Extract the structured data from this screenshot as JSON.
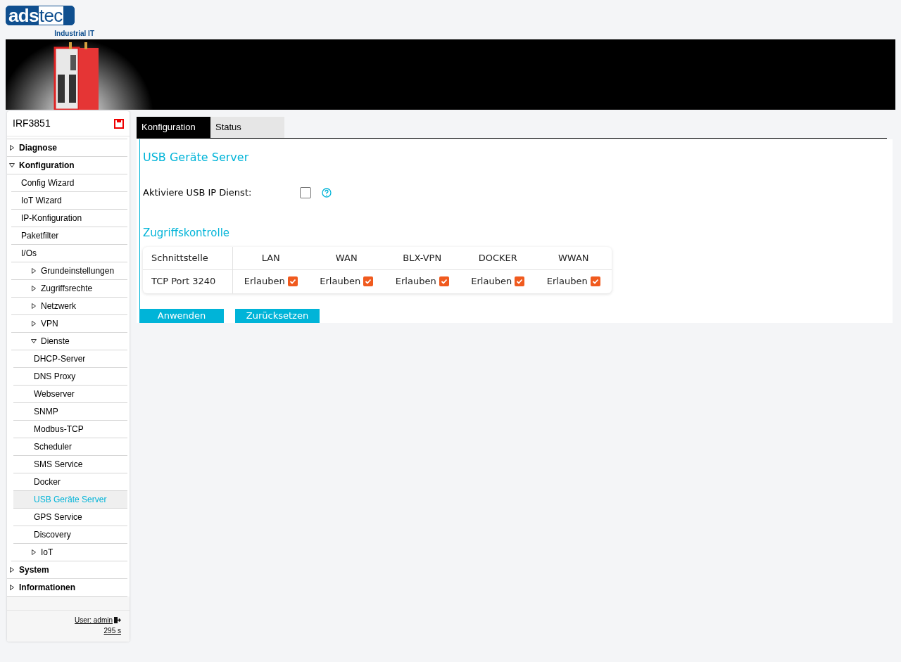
{
  "logo": {
    "left": "ads",
    "right": "tec",
    "tagline": "Industrial IT"
  },
  "sidebar": {
    "device": "IRF3851",
    "items": [
      {
        "label": "Diagnose",
        "expanded": false,
        "selected": false
      },
      {
        "label": "Konfiguration",
        "expanded": true,
        "selected": false,
        "children": [
          {
            "label": "Config Wizard",
            "selected": false
          },
          {
            "label": "IoT Wizard",
            "selected": false
          },
          {
            "label": "IP-Konfiguration",
            "selected": false
          },
          {
            "label": "Paketfilter",
            "selected": false
          },
          {
            "label": "I/Os",
            "selected": false,
            "children": [
              {
                "label": "Grundeinstellungen",
                "expanded": false,
                "selected": false
              },
              {
                "label": "Zugriffsrechte",
                "expanded": false,
                "selected": false
              },
              {
                "label": "Netzwerk",
                "expanded": false,
                "selected": false
              },
              {
                "label": "VPN",
                "expanded": false,
                "selected": false
              },
              {
                "label": "Dienste",
                "expanded": true,
                "selected": false,
                "children": [
                  {
                    "label": "DHCP-Server",
                    "selected": false
                  },
                  {
                    "label": "DNS Proxy",
                    "selected": false
                  },
                  {
                    "label": "Webserver",
                    "selected": false
                  },
                  {
                    "label": "SNMP",
                    "selected": false
                  },
                  {
                    "label": "Modbus-TCP",
                    "selected": false
                  },
                  {
                    "label": "Scheduler",
                    "selected": false
                  },
                  {
                    "label": "SMS Service",
                    "selected": false
                  },
                  {
                    "label": "Docker",
                    "selected": false
                  },
                  {
                    "label": "USB Geräte Server",
                    "selected": true
                  },
                  {
                    "label": "GPS Service",
                    "selected": false
                  },
                  {
                    "label": "Discovery",
                    "selected": false
                  }
                ]
              },
              {
                "label": "IoT",
                "expanded": false,
                "selected": false
              }
            ]
          }
        ]
      },
      {
        "label": "System",
        "expanded": false,
        "selected": false
      },
      {
        "label": "Informationen",
        "expanded": false,
        "selected": false
      }
    ],
    "user": "User: admin",
    "timer": "295 s"
  },
  "tabs": [
    {
      "label": "Konfiguration",
      "selected": true
    },
    {
      "label": "Status",
      "selected": false
    }
  ],
  "page": {
    "title": "USB Geräte Server",
    "service_label": "Aktiviere USB IP Dienst:",
    "service_enabled": false,
    "access_title": "Zugriffskontrolle",
    "table": {
      "columns": [
        "Schnittstelle",
        "LAN",
        "WAN",
        "BLX-VPN",
        "DOCKER",
        "WWAN"
      ],
      "rows": [
        {
          "cells": [
            {
              "kind": "text",
              "label": "TCP Port 3240"
            },
            {
              "kind": "checkbox",
              "label": "Erlauben",
              "checked": true
            },
            {
              "kind": "checkbox",
              "label": "Erlauben",
              "checked": true
            },
            {
              "kind": "checkbox",
              "label": "Erlauben",
              "checked": true
            },
            {
              "kind": "checkbox",
              "label": "Erlauben",
              "checked": true
            },
            {
              "kind": "checkbox",
              "label": "Erlauben",
              "checked": true
            }
          ]
        }
      ]
    },
    "buttons": [
      "Anwenden",
      "Zurücksetzen"
    ]
  }
}
